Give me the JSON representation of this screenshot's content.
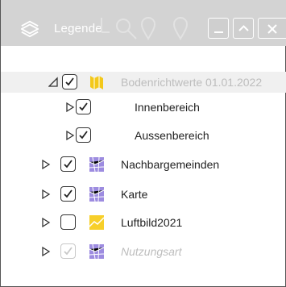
{
  "window": {
    "title": "Legende"
  },
  "tree": [
    {
      "label": "Bodenrichtwerte 01.01.2022",
      "checked": true,
      "expanded": true,
      "icon": "yellow-map-icon"
    },
    {
      "label": "Innenbereich",
      "checked": true,
      "expanded": false,
      "icon": "none"
    },
    {
      "label": "Aussenbereich",
      "checked": true,
      "expanded": false,
      "icon": "none"
    },
    {
      "label": "Nachbargemeinden",
      "checked": true,
      "expanded": false,
      "icon": "purple-map-icon"
    },
    {
      "label": "Karte",
      "checked": true,
      "expanded": false,
      "icon": "purple-map-icon"
    },
    {
      "label": "Luftbild2021",
      "checked": false,
      "expanded": false,
      "icon": "yellow-aerial-icon"
    },
    {
      "label": "Nutzungsart",
      "checked": true,
      "disabled": true,
      "expanded": false,
      "icon": "purple-map-icon"
    }
  ]
}
